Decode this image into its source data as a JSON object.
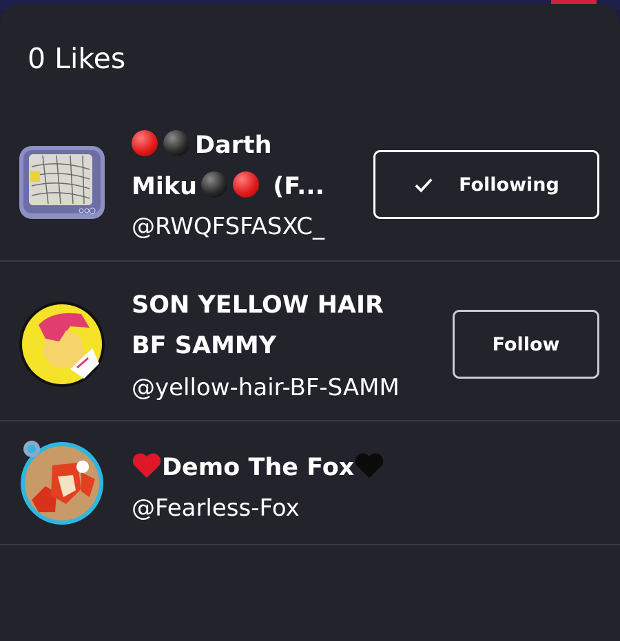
{
  "header": {
    "title": "0 Likes"
  },
  "likes_list": [
    {
      "name_line1": "Darth",
      "name_line2": "Miku",
      "name_line2_suffix": "(F...",
      "handle": "@RWQFSFASXC_",
      "button_label": "Following"
    },
    {
      "name_line1": "SON YELLOW HAIR",
      "name_line2": "BF SAMMY",
      "handle": "@yellow-hair-BF-SAMM",
      "button_label": "Follow"
    },
    {
      "name_line1": "Demo The Fox",
      "handle": "@Fearless-Fox"
    }
  ],
  "colors": {
    "sheet_background": "#22232b",
    "text": "#ffffff",
    "divider": "#3a3b44",
    "top_background": "#1e1f4a",
    "top_accent": "#d0213f"
  },
  "icons": [
    "checkmark-icon",
    "red-circle-emoji",
    "black-circle-emoji",
    "red-heart-emoji",
    "black-heart-emoji"
  ]
}
